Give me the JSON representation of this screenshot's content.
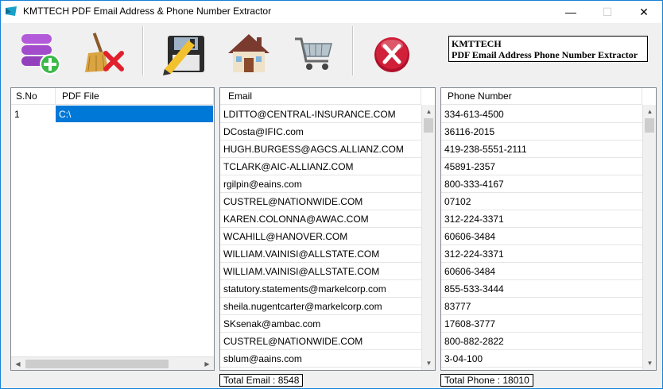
{
  "window": {
    "title": "KMTTECH PDF Email Address & Phone Number Extractor",
    "min_glyph": "—",
    "max_glyph": "☐",
    "close_glyph": "✕"
  },
  "toolbar": {
    "buttons": [
      {
        "name": "add-files",
        "icon": "database-add-icon"
      },
      {
        "name": "clear",
        "icon": "broom-clear-icon"
      },
      {
        "name": "save",
        "icon": "floppy-save-icon"
      },
      {
        "name": "home",
        "icon": "home-icon"
      },
      {
        "name": "buy",
        "icon": "cart-icon"
      },
      {
        "name": "exit",
        "icon": "exit-x-icon"
      }
    ],
    "brand_line1": "KMTTECH",
    "brand_line2": "PDF Email Address Phone Number Extractor"
  },
  "files": {
    "headers": [
      "S.No",
      "PDF File"
    ],
    "rows": [
      {
        "sno": "1",
        "file": "C:\\"
      }
    ]
  },
  "emails": {
    "header": "Email",
    "rows": [
      "LDITTO@CENTRAL-INSURANCE.COM",
      "DCosta@IFIC.com",
      "HUGH.BURGESS@AGCS.ALLIANZ.COM",
      "TCLARK@AIC-ALLIANZ.COM",
      "rgilpin@eains.com",
      "CUSTREL@NATIONWIDE.COM",
      "KAREN.COLONNA@AWAC.COM",
      "WCAHILL@HANOVER.COM",
      "WILLIAM.VAINISI@ALLSTATE.COM",
      "WILLIAM.VAINISI@ALLSTATE.COM",
      "statutory.statements@markelcorp.com",
      "sheila.nugentcarter@markelcorp.com",
      "SKsenak@ambac.com",
      "CUSTREL@NATIONWIDE.COM",
      "sblum@aains.com"
    ],
    "total_label": "Total Email : 8548"
  },
  "phones": {
    "header": "Phone Number",
    "rows": [
      "334-613-4500",
      "36116-2015",
      "419-238-5551-2111",
      "45891-2357",
      "800-333-4167",
      "07102",
      "312-224-3371",
      "60606-3484",
      "312-224-3371",
      "60606-3484",
      "855-533-3444",
      "83777",
      "17608-3777",
      "800-882-2822",
      " 3-04-100"
    ],
    "total_label": "Total Phone : 18010"
  },
  "colors": {
    "selection": "#0078d7",
    "window_border": "#1883d7",
    "exit_red": "#c8102e"
  }
}
